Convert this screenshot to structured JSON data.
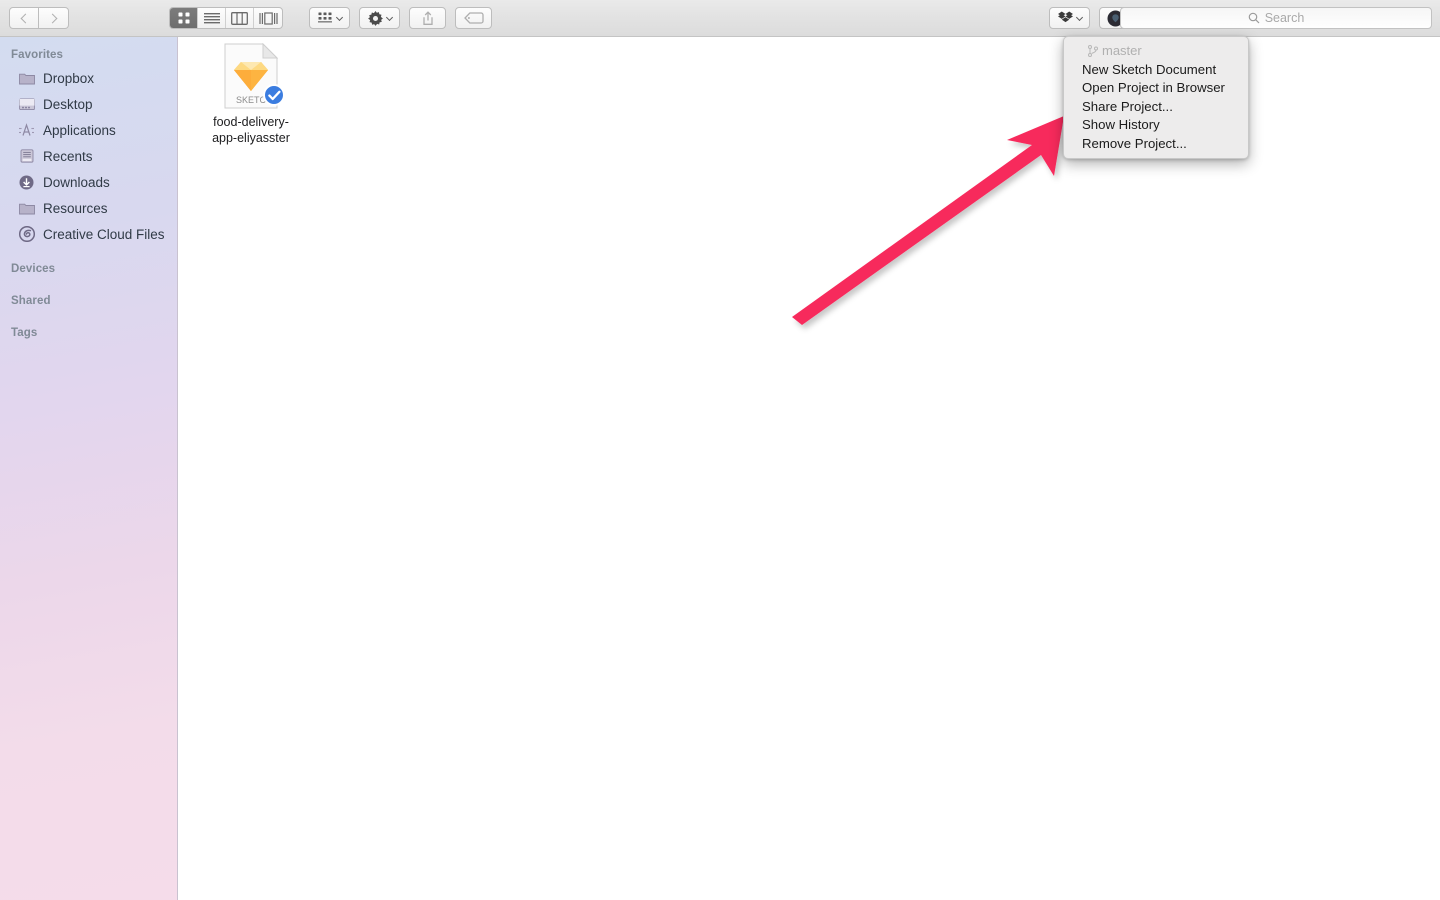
{
  "window": {
    "title": "Finder",
    "background_color": "#ffffff"
  },
  "toolbar": {
    "back_label": "Back",
    "forward_label": "Forward",
    "view_modes": [
      {
        "name": "icon-view",
        "label": "Icon View",
        "active": true
      },
      {
        "name": "list-view",
        "label": "List View",
        "active": false
      },
      {
        "name": "column-view",
        "label": "Column View",
        "active": false
      },
      {
        "name": "gallery-view",
        "label": "Gallery View",
        "active": false
      }
    ],
    "arrange_label": "Arrange",
    "action_label": "Action",
    "share_label": "Share",
    "tags_label": "Tags",
    "dropbox_label": "Dropbox",
    "abstract_label": "Abstract"
  },
  "search": {
    "placeholder": "Search",
    "value": ""
  },
  "sidebar": {
    "sections": [
      {
        "title": "Favorites",
        "items": [
          {
            "label": "Dropbox",
            "icon": "folder-icon"
          },
          {
            "label": "Desktop",
            "icon": "desktop-icon"
          },
          {
            "label": "Applications",
            "icon": "applications-icon"
          },
          {
            "label": "Recents",
            "icon": "recents-icon"
          },
          {
            "label": "Downloads",
            "icon": "downloads-icon"
          },
          {
            "label": "Resources",
            "icon": "folder-icon"
          },
          {
            "label": "Creative Cloud Files",
            "icon": "creative-cloud-icon"
          }
        ]
      },
      {
        "title": "Devices",
        "items": []
      },
      {
        "title": "Shared",
        "items": []
      },
      {
        "title": "Tags",
        "items": []
      }
    ]
  },
  "content": {
    "files": [
      {
        "name": "food-delivery-app-eliyasster",
        "name_line1": "food-delivery-",
        "name_line2": "app-eliyasster",
        "type": "SKETCH",
        "type_label": "SKETC",
        "badge": "check-badge",
        "selected": false
      }
    ]
  },
  "menu": {
    "branch_label": "master",
    "branch_icon": "git-branch-icon",
    "items": [
      {
        "label": "New Sketch Document"
      },
      {
        "label": "Open Project in Browser"
      },
      {
        "label": "Share Project..."
      },
      {
        "label": "Show History"
      },
      {
        "label": "Remove Project..."
      }
    ]
  },
  "annotation": {
    "arrow_color": "#F72A5C",
    "arrow_label": "pointer-arrow"
  }
}
